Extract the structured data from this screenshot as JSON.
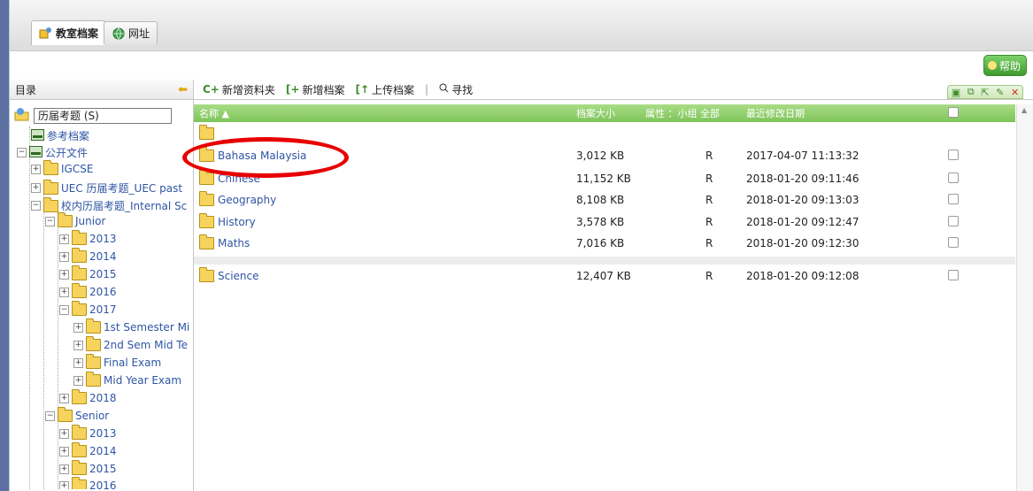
{
  "tabs": [
    {
      "label": "教室档案",
      "icon": "classroom-icon",
      "active": true
    },
    {
      "label": "网址",
      "icon": "globe-icon",
      "active": false
    }
  ],
  "help_label": "帮助",
  "sidebar": {
    "title": "目录",
    "root_label": "历届考题 (S)",
    "nodes": [
      "参考档案",
      "公开文件",
      "IGCSE",
      "UEC 历届考题_UEC past",
      "校内历届考题_Internal Sc",
      "Junior",
      "2013",
      "2014",
      "2015",
      "2016",
      "2017",
      "1st Semester Mi",
      "2nd Sem Mid Te",
      "Final Exam",
      "Mid Year Exam",
      "2018",
      "Senior",
      "2013",
      "2014",
      "2015",
      "2016"
    ]
  },
  "toolbar": {
    "new_folder": "新增资料夹",
    "new_file": "新增档案",
    "upload": "上传档案",
    "search": "寻找"
  },
  "table": {
    "headers": {
      "name": "名称",
      "size": "档案大小",
      "attr": "属性 ：小组 全部",
      "date": "最近修改日期"
    },
    "rows": [
      {
        "name": "Bahasa Malaysia",
        "size": "3,012 KB",
        "attr": "R",
        "date": "2017-04-07 11:13:32"
      },
      {
        "name": "Chinese",
        "size": "11,152 KB",
        "attr": "R",
        "date": "2018-01-20 09:11:46"
      },
      {
        "name": "Geography",
        "size": "8,108 KB",
        "attr": "R",
        "date": "2018-01-20 09:13:03"
      },
      {
        "name": "History",
        "size": "3,578 KB",
        "attr": "R",
        "date": "2018-01-20 09:12:47"
      },
      {
        "name": "Maths",
        "size": "7,016 KB",
        "attr": "R",
        "date": "2018-01-20 09:12:30"
      },
      {
        "name": "Science",
        "size": "12,407 KB",
        "attr": "R",
        "date": "2018-01-20 09:12:08"
      }
    ]
  },
  "colors": {
    "header_green": "#7ec45a",
    "link_blue": "#2f55a4",
    "annotation_red": "#e80000"
  }
}
